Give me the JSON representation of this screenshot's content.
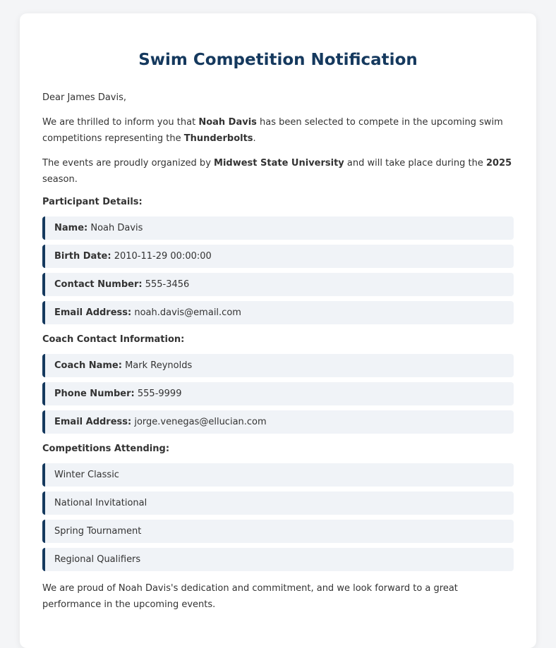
{
  "letter": {
    "title": "Swim Competition Notification",
    "greeting": "Dear James Davis,",
    "intro": {
      "part1": "We are thrilled to inform you that ",
      "athlete": "Noah Davis",
      "part2": " has been selected to compete in the upcoming swim competitions representing the ",
      "team": "Thunderbolts",
      "part3": "."
    },
    "organizer": {
      "part1": "The events are proudly organized by ",
      "org": "Midwest State University",
      "part2": " and will take place during the ",
      "season": "2025",
      "part3": " season."
    },
    "participant": {
      "heading": "Participant Details:",
      "items": [
        {
          "label": "Name:",
          "value": "Noah Davis"
        },
        {
          "label": "Birth Date:",
          "value": "2010-11-29 00:00:00"
        },
        {
          "label": "Contact Number:",
          "value": "555-3456"
        },
        {
          "label": "Email Address:",
          "value": "noah.davis@email.com"
        }
      ]
    },
    "coach": {
      "heading": "Coach Contact Information:",
      "items": [
        {
          "label": "Coach Name:",
          "value": "Mark Reynolds"
        },
        {
          "label": "Phone Number:",
          "value": "555-9999"
        },
        {
          "label": "Email Address:",
          "value": "jorge.venegas@ellucian.com"
        }
      ]
    },
    "competitions": {
      "heading": "Competitions Attending:",
      "items": [
        "Winter Classic",
        "National Invitational",
        "Spring Tournament",
        "Regional Qualifiers"
      ]
    },
    "closing": "We are proud of Noah Davis's dedication and commitment, and we look forward to a great performance in the upcoming events."
  }
}
